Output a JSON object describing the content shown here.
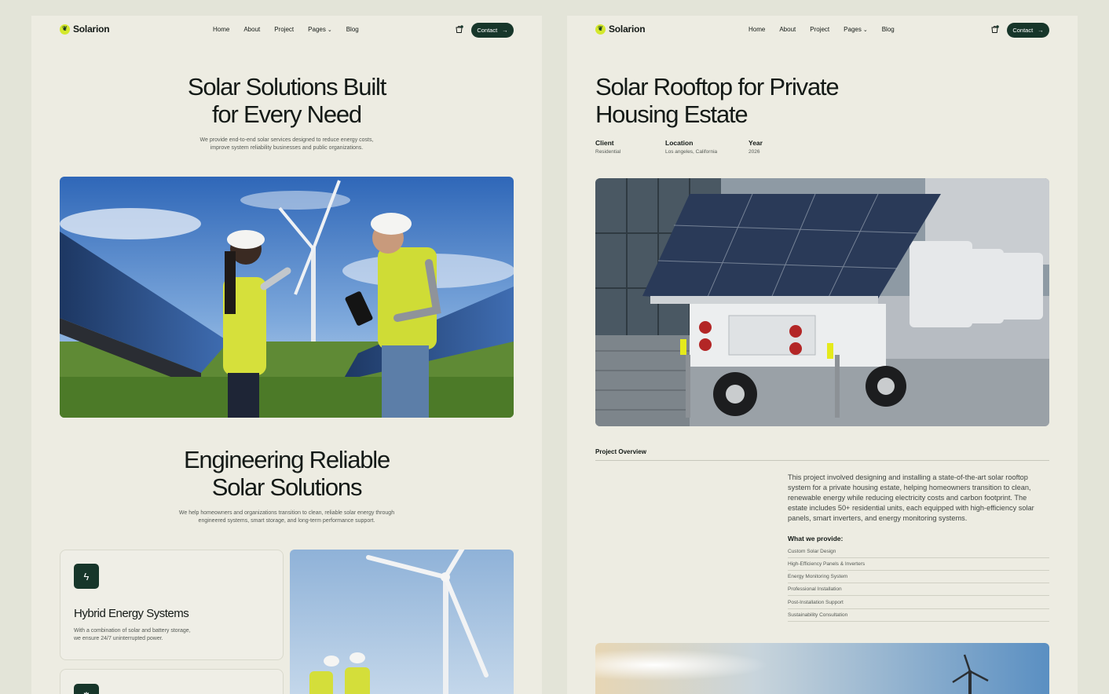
{
  "nav": {
    "brand": "Solarion",
    "brand_icon": "leaf-icon",
    "links": [
      "Home",
      "About",
      "Project",
      "Pages",
      "Blog"
    ],
    "contact_label": "Contact"
  },
  "left": {
    "hero_title_line1": "Solar Solutions Built",
    "hero_title_line2": "for Every Need",
    "hero_sub_line1": "We provide end-to-end solar services designed to reduce energy costs,",
    "hero_sub_line2": "improve system reliability businesses and public organizations.",
    "section_title_line1": "Engineering Reliable",
    "section_title_line2": "Solar Solutions",
    "section_sub_line1": "We help homeowners and organizations transition to clean, reliable solar energy through",
    "section_sub_line2": "engineered systems, smart storage, and long-term performance support.",
    "card_title": "Hybrid Energy Systems",
    "card_desc_line1": "With a combination of solar and battery storage,",
    "card_desc_line2": "we ensure 24/7 uninterrupted power."
  },
  "right": {
    "title_line1": "Solar Rooftop for Private",
    "title_line2": "Housing Estate",
    "meta": [
      {
        "label": "Client",
        "value": "Residential"
      },
      {
        "label": "Location",
        "value": "Los angeles, California"
      },
      {
        "label": "Year",
        "value": "2026"
      }
    ],
    "overview_label": "Project Overview",
    "overview_lines": [
      "This project involved designing and installing a state-of-the-art solar rooftop",
      "system for a private housing estate, helping homeowners transition to clean,",
      "renewable energy while reducing electricity costs and carbon footprint. The",
      "estate includes 50+ residential units, each equipped with high-efficiency solar",
      "panels, smart inverters, and energy monitoring systems."
    ],
    "provide_title": "What we provide:",
    "provide_items": [
      "Custom Solar Design",
      "High-Efficiency Panels & Inverters",
      "Energy Monitoring System",
      "Professional Installation",
      "Post-Installation Support",
      "Sustainability Consultation"
    ]
  }
}
